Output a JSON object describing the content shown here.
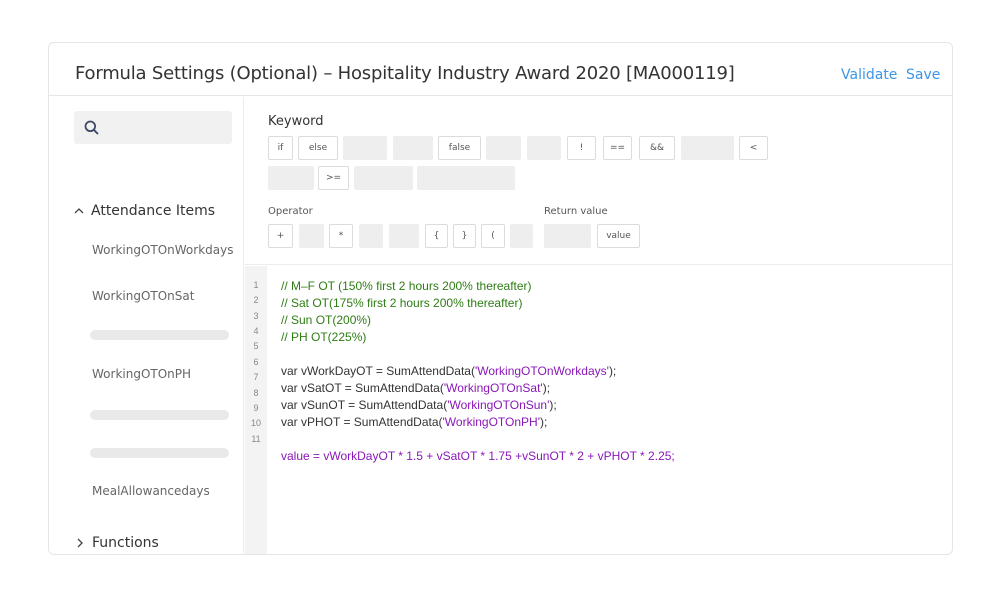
{
  "header": {
    "title": "Formula Settings (Optional) – Hospitality Industry Award 2020 [MA000119]",
    "validate_label": "Validate",
    "save_label": "Save"
  },
  "sidebar": {
    "search_icon": "search-icon",
    "groups": [
      {
        "label": "Attendance Items",
        "expanded": true
      },
      {
        "label": "Functions",
        "expanded": false
      }
    ],
    "items": [
      "WorkingOTOnWorkdays",
      "WorkingOTOnSat",
      "WorkingOTOnPH",
      "MealAllowancedays"
    ]
  },
  "keywords": {
    "label": "Keyword",
    "buttons": [
      "if",
      "else",
      "false",
      "!",
      "==",
      "&&",
      "<",
      ">="
    ]
  },
  "operators": {
    "label": "Operator",
    "buttons": [
      "+",
      "*",
      "{",
      "}",
      "("
    ]
  },
  "return_value": {
    "label": "Return value",
    "buttons": [
      "value"
    ]
  },
  "editor": {
    "line_numbers": [
      "1",
      "2",
      "3",
      "4",
      "5",
      "6",
      "7",
      "8",
      "9",
      "10",
      "11"
    ],
    "lines": [
      {
        "kind": "comment",
        "text": "// M–F OT (150% first 2 hours 200% thereafter)"
      },
      {
        "kind": "comment",
        "text": "// Sat OT(175% first 2 hours 200% thereafter)"
      },
      {
        "kind": "comment",
        "text": "// Sun OT(200%)"
      },
      {
        "kind": "comment",
        "text": "// PH OT(225%)"
      },
      {
        "kind": "blank",
        "text": ""
      },
      {
        "kind": "code",
        "prefix": "var vWorkDayOT = SumAttendData(",
        "string": "'WorkingOTOnWorkdays'",
        "suffix": ");"
      },
      {
        "kind": "code",
        "prefix": "var vSatOT = SumAttendData(",
        "string": "'WorkingOTOnSat'",
        "suffix": ");"
      },
      {
        "kind": "code",
        "prefix": "var vSunOT = SumAttendData(",
        "string": "'WorkingOTOnSun'",
        "suffix": ");"
      },
      {
        "kind": "code",
        "prefix": "var vPHOT = SumAttendData(",
        "string": "'WorkingOTOnPH'",
        "suffix": ");"
      },
      {
        "kind": "blank",
        "text": ""
      },
      {
        "kind": "expr",
        "text": "value = vWorkDayOT * 1.5 + vSatOT * 1.75 +vSunOT * 2 + vPHOT * 2.25;"
      }
    ]
  },
  "colors": {
    "accent": "#3d95e6",
    "comment": "#2e7d14",
    "string": "#8a18b8"
  }
}
